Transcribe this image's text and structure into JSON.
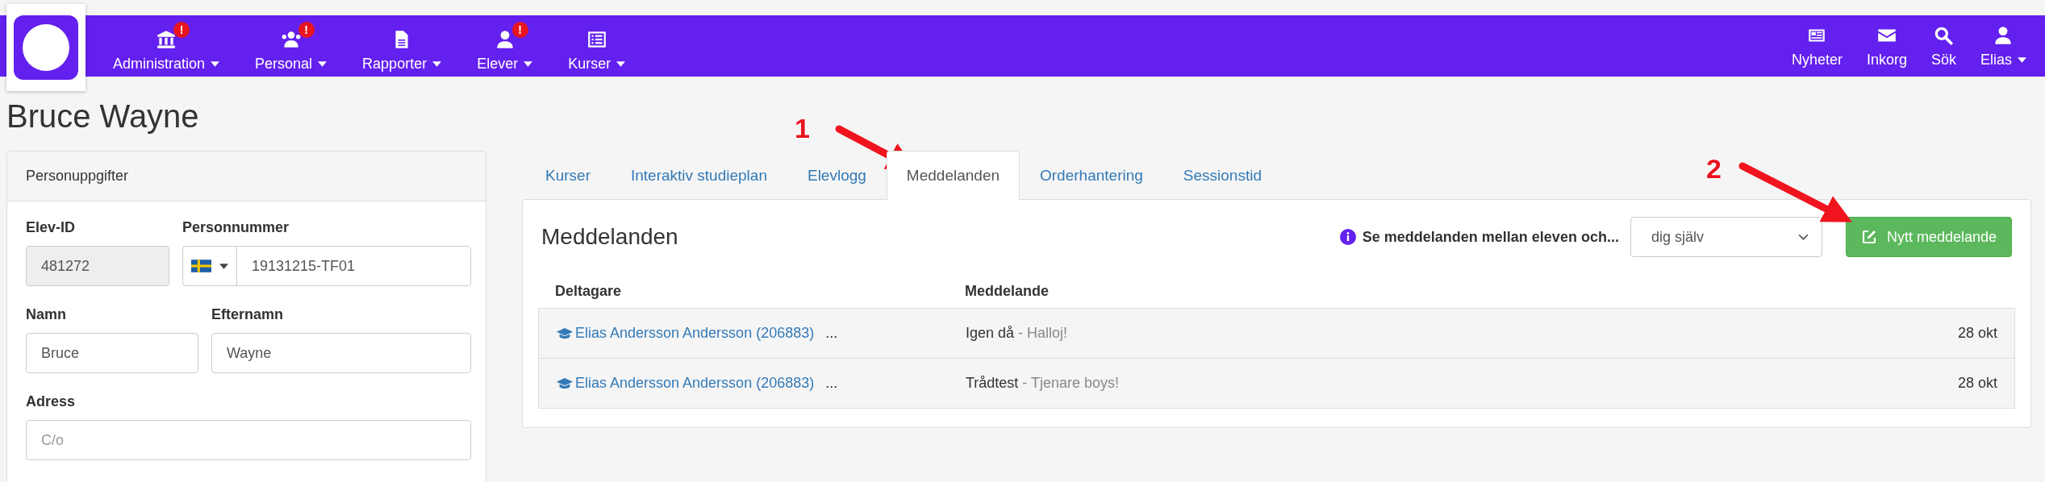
{
  "navbar": {
    "left_items": [
      {
        "label": "Administration",
        "badge": "!",
        "dropdown": true
      },
      {
        "label": "Personal",
        "badge": "!",
        "dropdown": true
      },
      {
        "label": "Rapporter",
        "dropdown": true
      },
      {
        "label": "Elever",
        "badge": "!",
        "dropdown": true
      },
      {
        "label": "Kurser",
        "dropdown": true
      }
    ],
    "right_items": [
      {
        "label": "Nyheter",
        "dropdown": false
      },
      {
        "label": "Inkorg",
        "dropdown": false
      },
      {
        "label": "Sök",
        "dropdown": false
      },
      {
        "label": "Elias",
        "dropdown": true
      }
    ]
  },
  "page_title": "Bruce Wayne",
  "personal_panel": {
    "title": "Personuppgifter",
    "fields": [
      {
        "label": "Elev-ID",
        "value": "481272",
        "kind": "readonly"
      },
      {
        "label": "Personnummer",
        "value": "19131215-TF01",
        "kind": "phone"
      },
      {
        "label": "Namn",
        "value": "Bruce",
        "kind": "text"
      },
      {
        "label": "Efternamn",
        "value": "Wayne",
        "kind": "text"
      },
      {
        "label": "Adress",
        "placeholder": "C/o",
        "kind": "wide"
      }
    ]
  },
  "tabs": [
    {
      "label": "Kurser",
      "selected": false
    },
    {
      "label": "Interaktiv studieplan",
      "selected": false
    },
    {
      "label": "Elevlogg",
      "selected": false
    },
    {
      "label": "Meddelanden",
      "selected": true
    },
    {
      "label": "Orderhantering",
      "selected": false
    },
    {
      "label": "Sessionstid",
      "selected": false
    }
  ],
  "messages": {
    "title": "Meddelanden",
    "filter_label": "Se meddelanden mellan eleven och...",
    "filter_value": "dig själv",
    "new_button": "Nytt meddelande",
    "columns": [
      "Deltagare",
      "Meddelande"
    ],
    "rows": [
      {
        "participant": "Elias Andersson Andersson (206883)",
        "more": "...",
        "subject": "Igen då",
        "preview": " - Halloj!",
        "date": "28 okt"
      },
      {
        "participant": "Elias Andersson Andersson (206883)",
        "more": "...",
        "subject": "Trådtest",
        "preview": " - Tjenare boys!",
        "date": "28 okt"
      }
    ]
  },
  "annotations": [
    {
      "label": "1"
    },
    {
      "label": "2"
    }
  ]
}
